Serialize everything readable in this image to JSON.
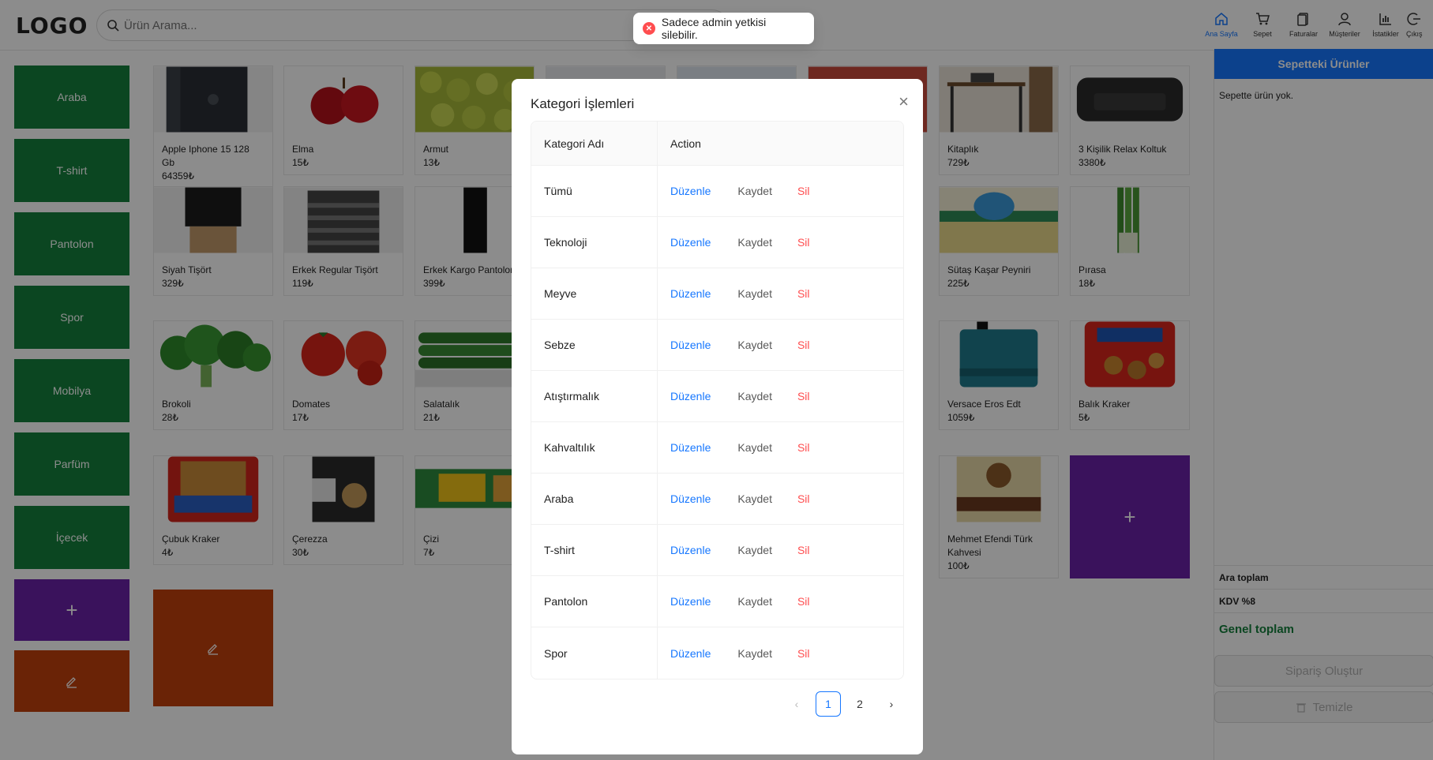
{
  "header": {
    "logo": "LOGO",
    "search_placeholder": "Ürün Arama...",
    "nav": [
      {
        "label": "Ana Sayfa",
        "icon": "home-icon"
      },
      {
        "label": "Sepet",
        "icon": "cart-icon"
      },
      {
        "label": "Faturalar",
        "icon": "invoice-icon"
      },
      {
        "label": "Müşteriler",
        "icon": "user-icon"
      },
      {
        "label": "İstatikler",
        "icon": "chart-icon"
      },
      {
        "label": "Çıkış",
        "icon": "logout-icon"
      }
    ]
  },
  "categories": [
    "Araba",
    "T-shirt",
    "Pantolon",
    "Spor",
    "Mobilya",
    "Parfüm",
    "İçecek"
  ],
  "add_symbol": "+",
  "products": [
    {
      "name": "Apple Iphone 15 128 Gb",
      "price": "64359₺"
    },
    {
      "name": "Elma",
      "price": "15₺"
    },
    {
      "name": "Armut",
      "price": "13₺"
    },
    {
      "name": "Kitaplık",
      "price": "729₺"
    },
    {
      "name": "3 Kişilik Relax Koltuk",
      "price": "3380₺"
    },
    {
      "name": "Siyah Tişört",
      "price": "329₺"
    },
    {
      "name": "Erkek Regular Tişört",
      "price": "119₺"
    },
    {
      "name": "Erkek Kargo Pantolon",
      "price": "399₺"
    },
    {
      "name": "Sütaş Kaşar Peyniri",
      "price": "225₺"
    },
    {
      "name": "Pırasa",
      "price": "18₺"
    },
    {
      "name": "Brokoli",
      "price": "28₺"
    },
    {
      "name": "Domates",
      "price": "17₺"
    },
    {
      "name": "Salatalık",
      "price": "21₺"
    },
    {
      "name": "Versace Eros Edt",
      "price": "1059₺"
    },
    {
      "name": "Balık Kraker",
      "price": "5₺"
    },
    {
      "name": "Çubuk Kraker",
      "price": "4₺"
    },
    {
      "name": "Çerezza",
      "price": "30₺"
    },
    {
      "name": "Çizi",
      "price": "7₺"
    },
    {
      "name": "Mehmet Efendi Türk Kahvesi",
      "price": "100₺"
    }
  ],
  "cart": {
    "title": "Sepetteki Ürünler",
    "empty": "Sepette ürün yok.",
    "subtotal": "Ara toplam",
    "vat": "KDV %8",
    "total": "Genel toplam",
    "order_button": "Sipariş Oluştur",
    "clear_button": "Temizle"
  },
  "toast": {
    "message": "Sadece admin yetkisi silebilir."
  },
  "modal": {
    "title": "Kategori İşlemleri",
    "columns": [
      "Kategori Adı",
      "Action"
    ],
    "rows": [
      "Tümü",
      "Teknoloji",
      "Meyve",
      "Sebze",
      "Atıştırmalık",
      "Kahvaltılık",
      "Araba",
      "T-shirt",
      "Pantolon",
      "Spor"
    ],
    "actions": {
      "edit": "Düzenle",
      "save": "Kaydet",
      "delete": "Sil"
    },
    "pagination": {
      "pages": [
        "1",
        "2"
      ],
      "current": "1"
    }
  },
  "colors": {
    "category": "#15803d",
    "add": "#6b21a8",
    "edit": "#c2410c",
    "primary": "#1677ff",
    "danger": "#ff4d4f"
  }
}
